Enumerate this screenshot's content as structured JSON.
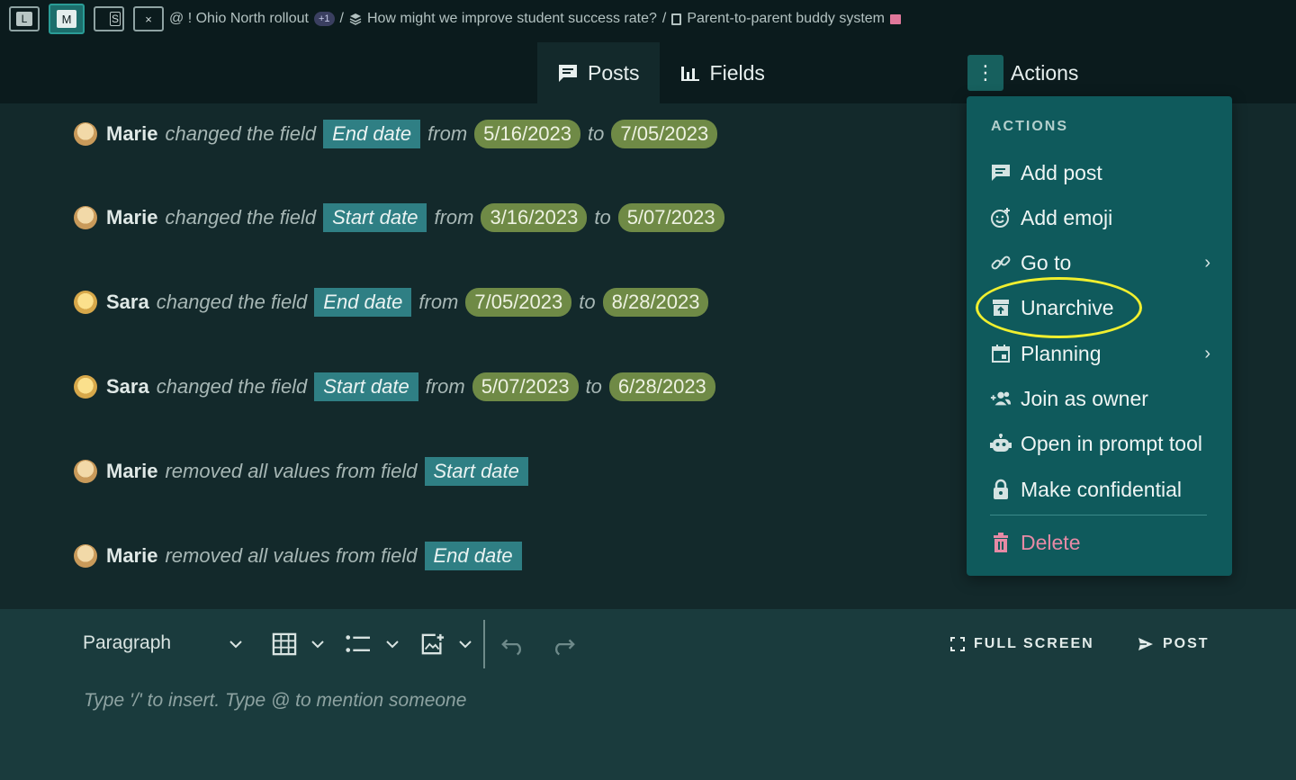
{
  "view_buttons": [
    {
      "label": "L"
    },
    {
      "label": "M"
    },
    {
      "label": "S"
    },
    {
      "label": "×"
    }
  ],
  "breadcrumb": {
    "prefix": "@ ! Ohio North rollout",
    "badge": "+1",
    "sep1": "/",
    "item2": "How might we improve student success rate?",
    "sep2": "/",
    "item3": "Parent-to-parent buddy system"
  },
  "tabs": [
    {
      "label": "Posts"
    },
    {
      "label": "Fields"
    }
  ],
  "actions": {
    "kebab": "⋮",
    "label": "Actions"
  },
  "feed": [
    {
      "user": "Marie",
      "verb": "changed the field",
      "field": "End date",
      "from_word": "from",
      "from": "5/16/2023",
      "to_word": "to",
      "to": "7/05/2023",
      "avatar": "marie"
    },
    {
      "user": "Marie",
      "verb": "changed the field",
      "field": "Start date",
      "from_word": "from",
      "from": "3/16/2023",
      "to_word": "to",
      "to": "5/07/2023",
      "avatar": "marie"
    },
    {
      "user": "Sara",
      "verb": "changed the field",
      "field": "End date",
      "from_word": "from",
      "from": "7/05/2023",
      "to_word": "to",
      "to": "8/28/2023",
      "avatar": "sara"
    },
    {
      "user": "Sara",
      "verb": "changed the field",
      "field": "Start date",
      "from_word": "from",
      "from": "5/07/2023",
      "to_word": "to",
      "to": "6/28/2023",
      "avatar": "sara"
    },
    {
      "user": "Marie",
      "verb": "removed all values from field",
      "field": "Start date",
      "avatar": "marie"
    },
    {
      "user": "Marie",
      "verb": "removed all values from field",
      "field": "End date",
      "avatar": "marie"
    }
  ],
  "menu": {
    "title": "ACTIONS",
    "items": [
      {
        "label": "Add post",
        "icon": "comment-icon"
      },
      {
        "label": "Add emoji",
        "icon": "emoji-add-icon"
      },
      {
        "label": "Go to",
        "icon": "link-icon",
        "submenu": "›"
      },
      {
        "label": "Unarchive",
        "icon": "unarchive-icon"
      },
      {
        "label": "Planning",
        "icon": "calendar-icon",
        "submenu": "›"
      },
      {
        "label": "Join as owner",
        "icon": "group-add-icon"
      },
      {
        "label": "Open in prompt tool",
        "icon": "robot-icon"
      },
      {
        "label": "Make confidential",
        "icon": "lock-icon"
      },
      {
        "label": "Delete",
        "icon": "trash-icon"
      }
    ]
  },
  "editor": {
    "paragraph": "Paragraph",
    "fullscreen": "FULL SCREEN",
    "post": "POST",
    "placeholder": "Type '/' to insert. Type @ to mention someone"
  },
  "colors": {
    "accent": "#0f5a5c",
    "highlight": "#f0ef2f",
    "date_chip": "#6f8a46",
    "field_chip": "#2f7f84",
    "delete": "#e68aa5"
  }
}
